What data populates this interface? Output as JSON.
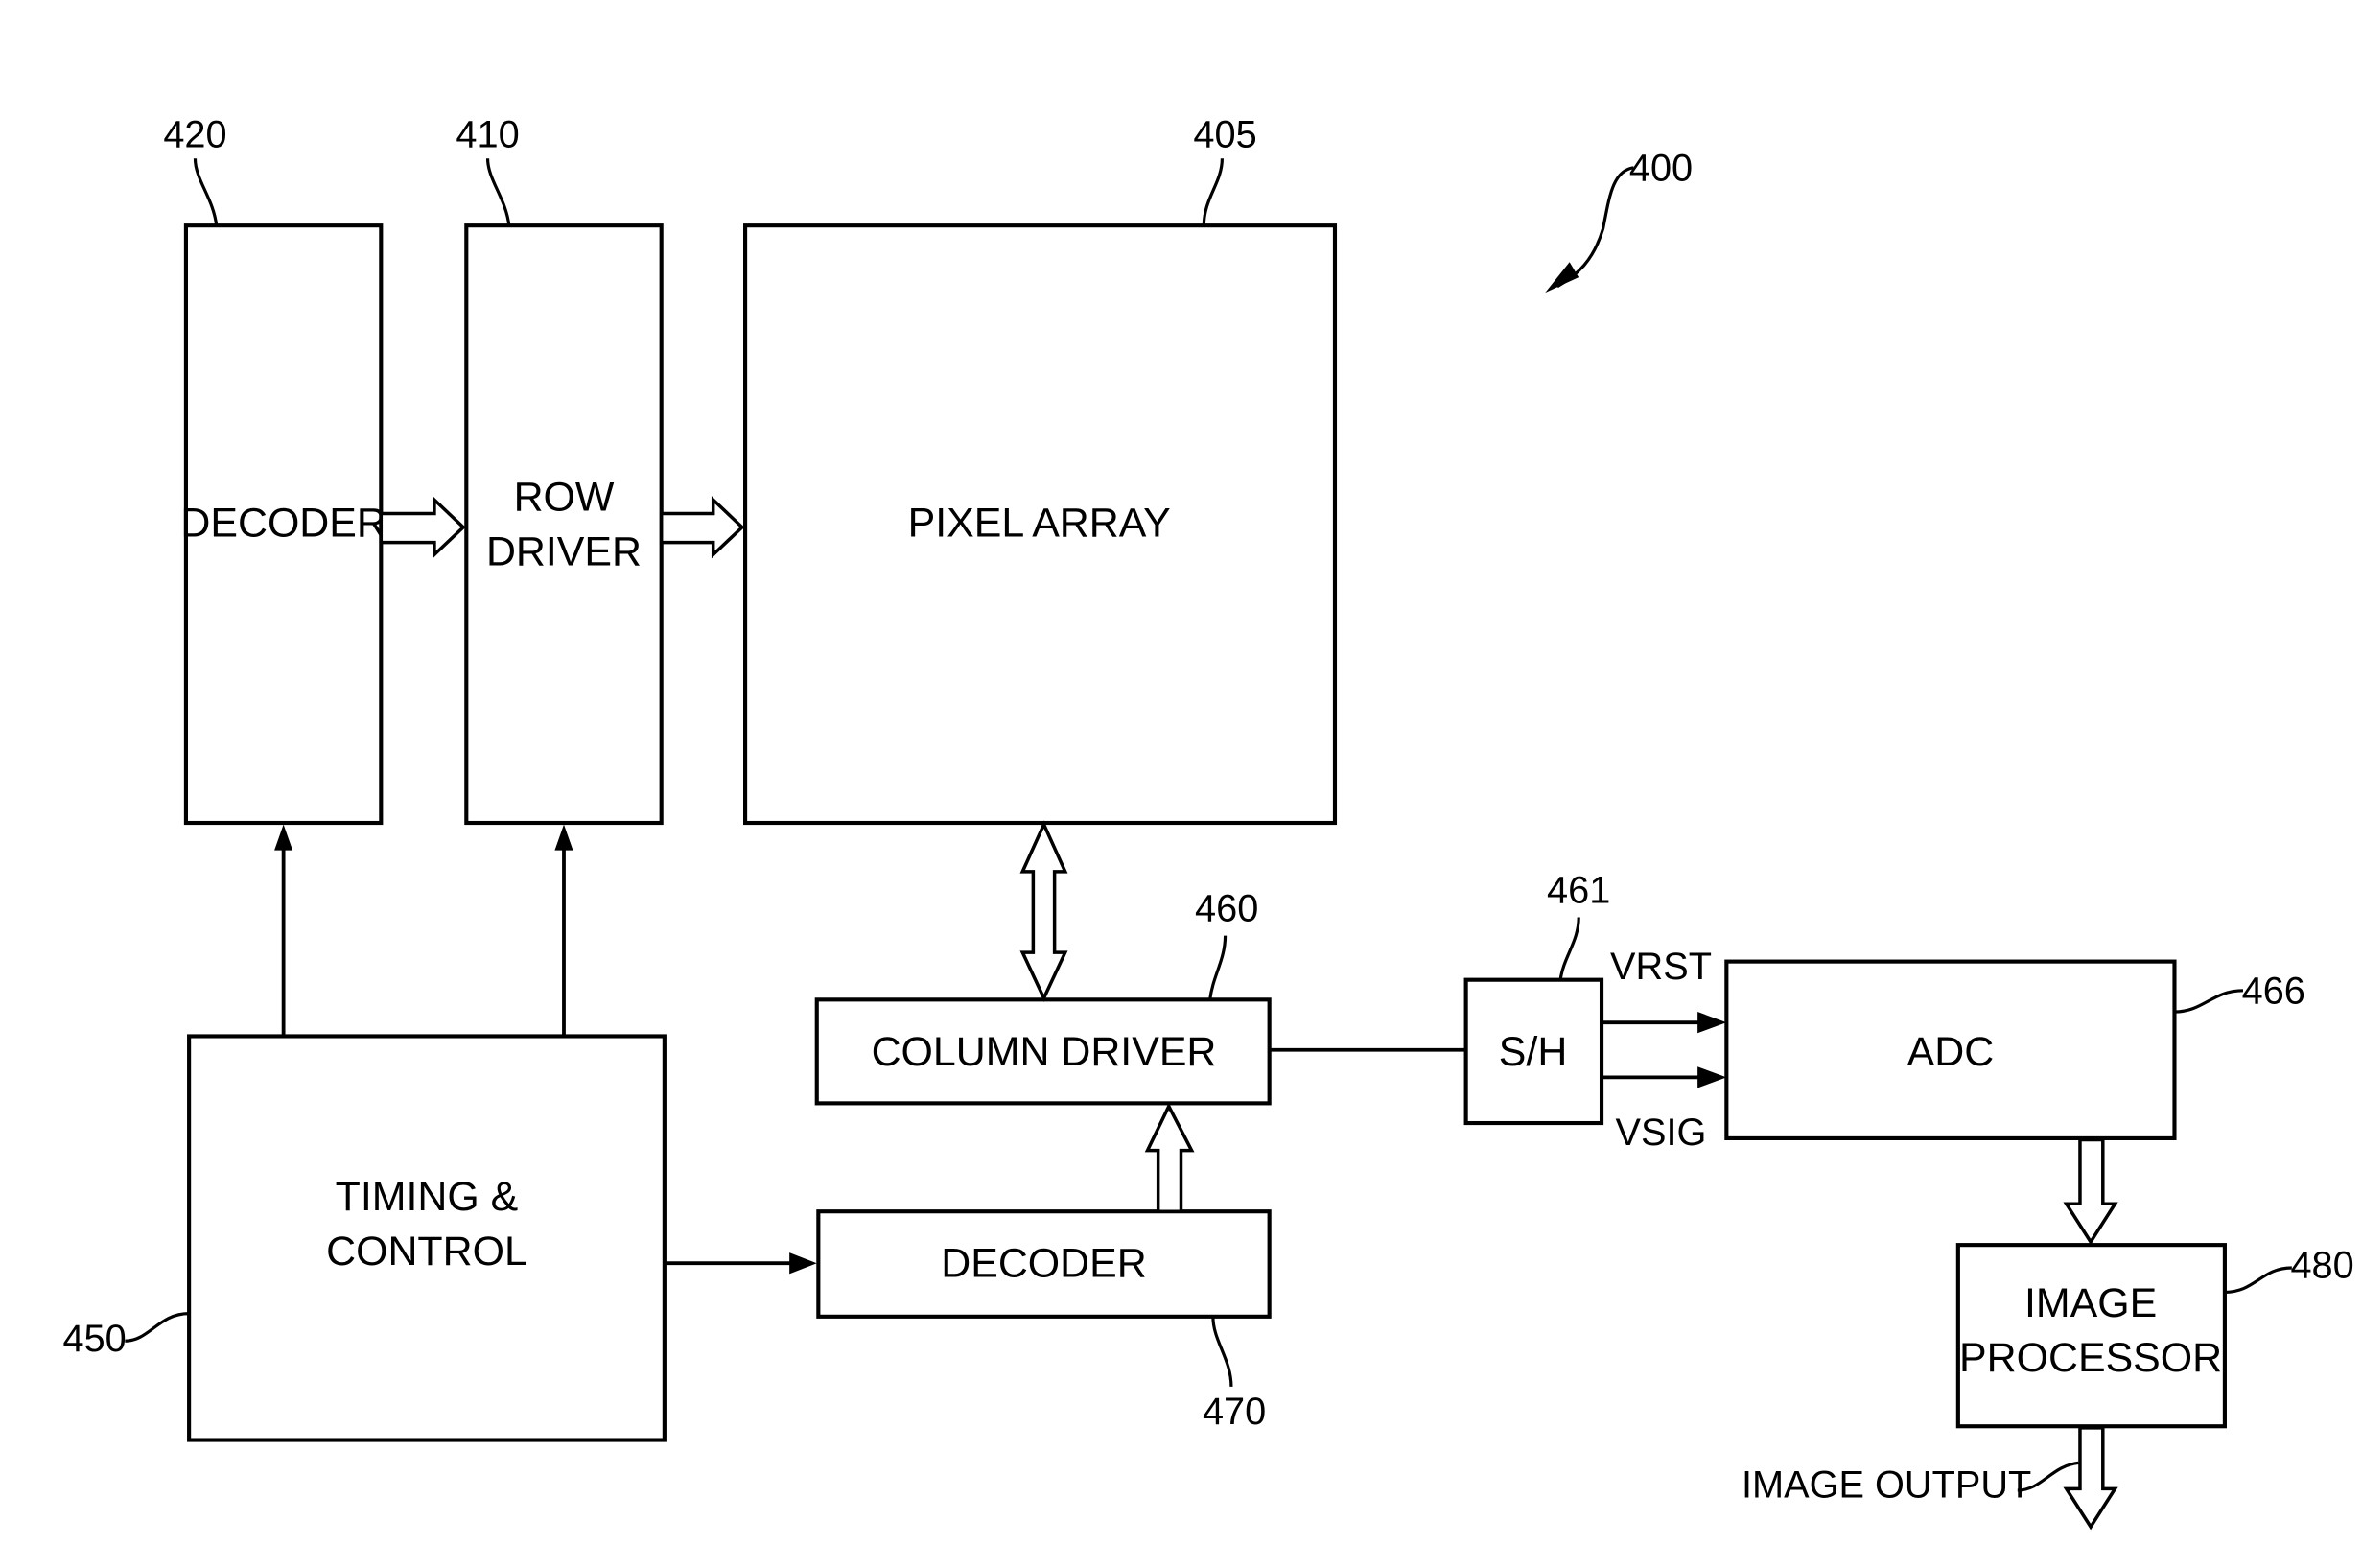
{
  "figure": {
    "reference": "400",
    "blocks": {
      "decoder_row": {
        "label": "DECODER",
        "ref": "420"
      },
      "row_driver": {
        "label_line1": "ROW",
        "label_line2": "DRIVER",
        "ref": "410"
      },
      "pixel_array": {
        "label": "PIXEL ARRAY",
        "ref": "405"
      },
      "timing_control": {
        "label_line1": "TIMING &",
        "label_line2": "CONTROL",
        "ref": "450"
      },
      "column_driver": {
        "label": "COLUMN DRIVER",
        "ref": "460"
      },
      "decoder_column": {
        "label": "DECODER",
        "ref": "470"
      },
      "sample_hold": {
        "label": "S/H",
        "ref": "461"
      },
      "adc": {
        "label": "ADC",
        "ref": "466"
      },
      "image_processor": {
        "label_line1": "IMAGE",
        "label_line2": "PROCESSOR",
        "ref": "480"
      }
    },
    "signals": {
      "vrst": "VRST",
      "vsig": "VSIG",
      "image_output": "IMAGE OUTPUT"
    }
  }
}
